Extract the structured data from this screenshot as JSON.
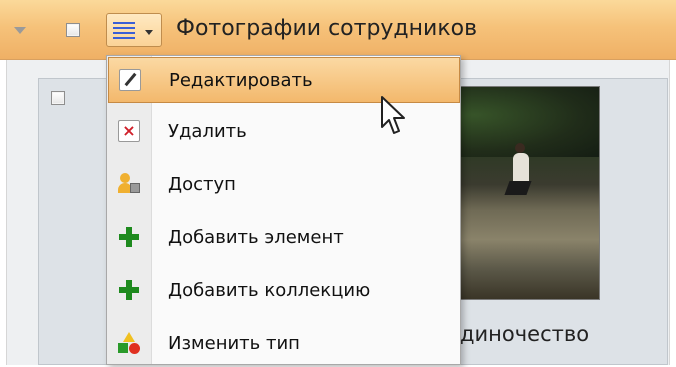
{
  "header": {
    "title": "Фотографии сотрудников"
  },
  "context_menu": {
    "items": [
      {
        "label": "Редактировать",
        "icon": "pencil-icon"
      },
      {
        "label": "Удалить",
        "icon": "delete-icon"
      },
      {
        "label": "Доступ",
        "icon": "access-icon"
      },
      {
        "label": "Добавить элемент",
        "icon": "add-icon"
      },
      {
        "label": "Добавить коллекцию",
        "icon": "add-icon"
      },
      {
        "label": "Изменить тип",
        "icon": "change-type-icon"
      }
    ],
    "hovered_index": 0
  },
  "card": {
    "caption": "диночество"
  },
  "colors": {
    "header_accent": "#f6c27a",
    "hover_highlight": "#f3b86c",
    "add_green": "#1e8a1e",
    "delete_red": "#d0202a"
  }
}
